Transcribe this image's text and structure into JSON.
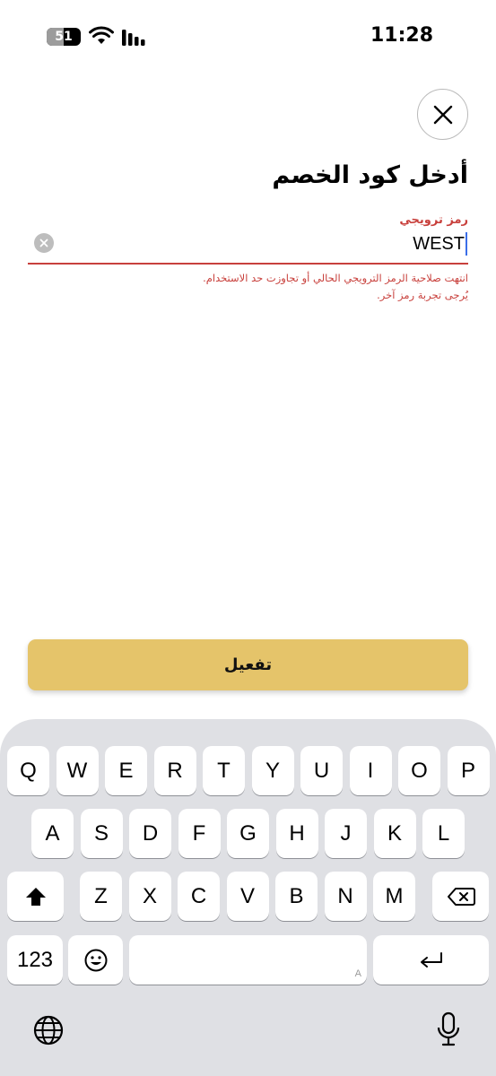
{
  "status_bar": {
    "time": "11:28",
    "battery_percent": "51",
    "battery_level": 0.51,
    "icons": [
      "battery-icon",
      "wifi-icon",
      "cellular-signal-icon"
    ]
  },
  "header": {
    "title": "أدخل كود الخصم",
    "close_icon": "close-icon"
  },
  "promo_field": {
    "label": "رمز ترويجي",
    "value": "WEST",
    "clear_icon": "clear-circle-icon",
    "error_line1": "انتهت صلاحية الرمز الترويجي الحالي أو تجاوزت حد الاستخدام.",
    "error_line2": "يُرجى تجربة رمز آخر.",
    "error_color": "#c8403c"
  },
  "actions": {
    "activate_label": "تفعيل",
    "activate_color": "#e5c46a"
  },
  "keyboard": {
    "row1": [
      "Q",
      "W",
      "E",
      "R",
      "T",
      "Y",
      "U",
      "I",
      "O",
      "P"
    ],
    "row2": [
      "A",
      "S",
      "D",
      "F",
      "G",
      "H",
      "J",
      "K",
      "L"
    ],
    "row3": [
      "Z",
      "X",
      "C",
      "V",
      "B",
      "N",
      "M"
    ],
    "numbers_label": "123",
    "space_hint": "A",
    "shift_icon": "shift-icon",
    "backspace_icon": "backspace-icon",
    "emoji_icon": "emoji-icon",
    "return_icon": "return-icon",
    "globe_icon": "globe-icon",
    "mic_icon": "microphone-icon"
  }
}
